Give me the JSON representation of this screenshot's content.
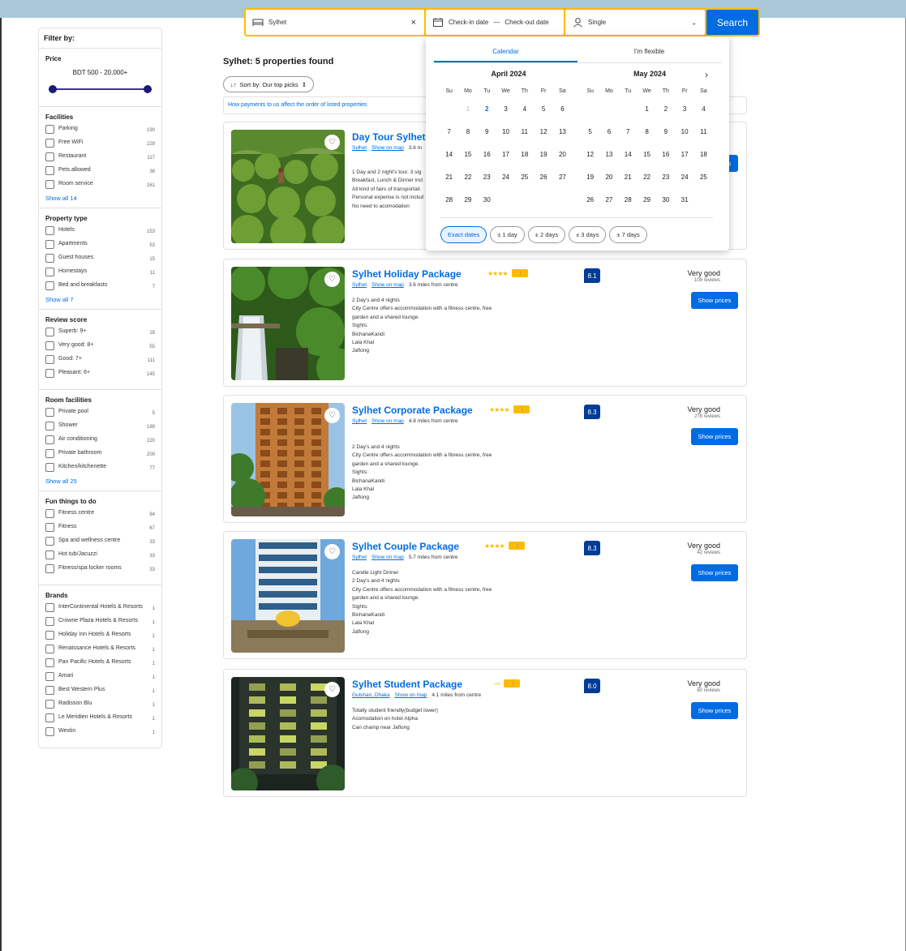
{
  "search": {
    "destination": "Sylhet",
    "checkin": "Check-in date",
    "checkout": "Check-out date",
    "guests": "Single",
    "button": "Search"
  },
  "filters": {
    "heading": "Filter by:",
    "price": {
      "title": "Price",
      "range_label": "BDT 500 - 20,000+",
      "min_fraction": 0,
      "max_fraction": 1
    },
    "facilities": {
      "title": "Facilities",
      "items": [
        {
          "label": "Parking",
          "count": "190"
        },
        {
          "label": "Free WiFi",
          "count": "229"
        },
        {
          "label": "Restaurant",
          "count": "117"
        },
        {
          "label": "Pets allowed",
          "count": "38"
        },
        {
          "label": "Room service",
          "count": "161"
        }
      ],
      "show_all": "Show all 14"
    },
    "property_type": {
      "title": "Property type",
      "items": [
        {
          "label": "Hotels",
          "count": "153"
        },
        {
          "label": "Apartments",
          "count": "53"
        },
        {
          "label": "Guest houses",
          "count": "15"
        },
        {
          "label": "Homestays",
          "count": "11"
        },
        {
          "label": "Bed and breakfasts",
          "count": "7"
        }
      ],
      "show_all": "Show all 7"
    },
    "review_score": {
      "title": "Review score",
      "items": [
        {
          "label": "Superb: 9+",
          "count": "18"
        },
        {
          "label": "Very good: 8+",
          "count": "55"
        },
        {
          "label": "Good: 7+",
          "count": "111"
        },
        {
          "label": "Pleasant: 6+",
          "count": "145"
        }
      ]
    },
    "room_facilities": {
      "title": "Room facilities",
      "items": [
        {
          "label": "Private pool",
          "count": "5"
        },
        {
          "label": "Shower",
          "count": "189"
        },
        {
          "label": "Air conditioning",
          "count": "220"
        },
        {
          "label": "Private bathroom",
          "count": "200"
        },
        {
          "label": "Kitchen/kitchenette",
          "count": "77"
        }
      ],
      "show_all": "Show all 25"
    },
    "fun_things": {
      "title": "Fun things to do",
      "items": [
        {
          "label": "Fitness centre",
          "count": "84"
        },
        {
          "label": "Fitness",
          "count": "67"
        },
        {
          "label": "Spa and wellness centre",
          "count": "33"
        },
        {
          "label": "Hot tub/Jacuzzi",
          "count": "33"
        },
        {
          "label": "Fitness/spa locker rooms",
          "count": "33"
        }
      ]
    },
    "brands": {
      "title": "Brands",
      "items": [
        {
          "label": "InterContinental Hotels & Resorts",
          "count": "1"
        },
        {
          "label": "Crowne Plaza Hotels & Resorts",
          "count": "1"
        },
        {
          "label": "Holiday Inn Hotels & Resorts",
          "count": "1"
        },
        {
          "label": "Renaissance Hotels & Resorts",
          "count": "1"
        },
        {
          "label": "Pan Pacific Hotels & Resorts",
          "count": "1"
        },
        {
          "label": "Amari",
          "count": "1"
        },
        {
          "label": "Best Western Plus",
          "count": "1"
        },
        {
          "label": "Radisson Blu",
          "count": "1"
        },
        {
          "label": "Le Meridien Hotels & Resorts",
          "count": "1"
        },
        {
          "label": "Westin",
          "count": "1"
        }
      ]
    }
  },
  "results": {
    "title": "Sylhet: 5 properties found",
    "sort_label": "Sort by: Our top picks",
    "payments_link": "How payments to us affect the order of listed properties",
    "show_prices": "Show prices",
    "cards": [
      {
        "name": "Day Tour Sylhet",
        "location": "Sylhet",
        "map": "Show on map",
        "distance": "3.6 m",
        "desc": [
          "1 Day and 2 night's tour. 3 sig",
          "Breakfast, Lunch & Dinner incl",
          "All kind of fairs of transportati",
          "Personal expense is not includ",
          "No  need to acomodation"
        ],
        "score": "",
        "rating_word": "",
        "reviews": "",
        "stars": 0,
        "photo": "tea"
      },
      {
        "name": "Sylhet Holiday Package",
        "location": "Sylhet",
        "map": "Show on map",
        "distance": "3.6 miles from centre",
        "desc": [
          "2 Day's and 4 nights",
          "City Centre offers accommodation with a fitness centre, free",
          "garden and a shared lounge.",
          "Sights:",
          "BichanaKandi",
          "Lala Khal",
          "Jaflong"
        ],
        "score": "8.1",
        "rating_word": "Very good",
        "reviews": "109 reviews",
        "stars": 4,
        "photo": "waterfall"
      },
      {
        "name": "Sylhet Corporate Package",
        "location": "Sylhet",
        "map": "Show on map",
        "distance": "4.8 miles from centre",
        "desc": [
          "2 Day's and 4 nights",
          "City Centre offers accommodation with a fitness centre, free",
          "garden and a shared lounge.",
          "Sights:",
          "BichanaKandi",
          "Lala Khal",
          "Jaflong"
        ],
        "score": "8.3",
        "rating_word": "Very good",
        "reviews": "278 reviews",
        "stars": 4,
        "photo": "tower"
      },
      {
        "name": "Sylhet Couple Package",
        "location": "Sylhet",
        "map": "Show on map",
        "distance": "5.7 miles from centre",
        "desc": [
          "Candle Light Dinner",
          "2 Day's and 4 nights",
          "City Centre offers accommodation with a fitness centre, free",
          "garden and a shared lounge.",
          "Sights:",
          "BichanaKandi",
          "Lala Khal",
          "Jaflong"
        ],
        "score": "8.3",
        "rating_word": "Very good",
        "reviews": "42 reviews",
        "stars": 4,
        "photo": "hotel"
      },
      {
        "name": "Sylhet Student Package",
        "location": "Gulshan, Dhaka",
        "map": "Show on map",
        "distance": "4.1 miles from centre",
        "desc": [
          "Totally student friendly(budget lower)",
          "Acomodation on hotel Alpha",
          "Can champ near Jaflong"
        ],
        "score": "8.0",
        "rating_word": "Very good",
        "reviews": "60 reviews",
        "stars": 4,
        "photo": "night"
      }
    ]
  },
  "calendar": {
    "tabs": [
      "Calendar",
      "I'm flexible"
    ],
    "dow": [
      "Su",
      "Mo",
      "Tu",
      "We",
      "Th",
      "Fr",
      "Sa"
    ],
    "months": [
      {
        "title": "April 2024",
        "offset": 1,
        "days": 30,
        "past_until": 1,
        "today": 2
      },
      {
        "title": "May 2024",
        "offset": 3,
        "days": 31,
        "past_until": 0,
        "today": 0
      }
    ],
    "flex_options": [
      "Exact dates",
      "± 1 day",
      "± 2 days",
      "± 3 days",
      "± 7 days"
    ]
  },
  "colors": {
    "brand_blue": "#006ce4",
    "score_blue": "#003b95",
    "accent_yellow": "#febb02",
    "header_band": "#a8c8d8"
  }
}
